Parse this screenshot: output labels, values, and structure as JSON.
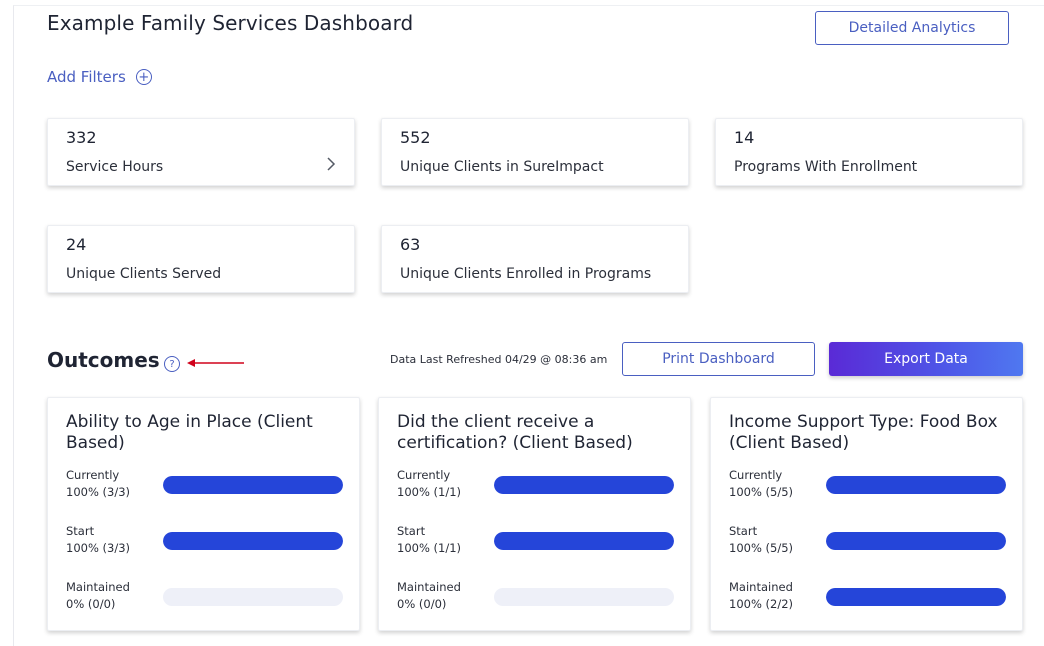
{
  "header": {
    "title": "Example Family Services Dashboard",
    "analytics_button": "Detailed Analytics",
    "add_filters": "Add Filters",
    "add_filters_icon": "plus-circle-icon"
  },
  "stats": [
    {
      "value": "332",
      "label": "Service Hours",
      "has_chevron": true
    },
    {
      "value": "552",
      "label": "Unique Clients in SureImpact"
    },
    {
      "value": "14",
      "label": "Programs With Enrollment"
    },
    {
      "value": "24",
      "label": "Unique Clients Served"
    },
    {
      "value": "63",
      "label": "Unique Clients Enrolled in Programs"
    }
  ],
  "outcomes": {
    "title": "Outcomes",
    "help_icon": "question-circle-icon",
    "refreshed": "Data Last Refreshed 04/29 @ 08:36 am",
    "print_button": "Print Dashboard",
    "export_button": "Export Data",
    "cards": [
      {
        "title": "Ability to Age in Place (Client Based)",
        "metrics": [
          {
            "name": "Currently",
            "value": "100% (3/3)",
            "fill": 1.0
          },
          {
            "name": "Start",
            "value": "100% (3/3)",
            "fill": 1.0
          },
          {
            "name": "Maintained",
            "value": "0% (0/0)",
            "fill": 0.0
          }
        ]
      },
      {
        "title": "Did the client receive a certification? (Client Based)",
        "metrics": [
          {
            "name": "Currently",
            "value": "100% (1/1)",
            "fill": 1.0
          },
          {
            "name": "Start",
            "value": "100% (1/1)",
            "fill": 1.0
          },
          {
            "name": "Maintained",
            "value": "0% (0/0)",
            "fill": 0.0
          }
        ]
      },
      {
        "title": "Income Support Type: Food Box (Client Based)",
        "metrics": [
          {
            "name": "Currently",
            "value": "100% (5/5)",
            "fill": 1.0
          },
          {
            "name": "Start",
            "value": "100% (5/5)",
            "fill": 1.0
          },
          {
            "name": "Maintained",
            "value": "100% (2/2)",
            "fill": 1.0
          }
        ]
      }
    ]
  },
  "colors": {
    "accent": "#4a5fc1",
    "bar_fill": "#2545d9",
    "bar_track": "#eef0f8",
    "export_gradient_start": "#5a2ad6",
    "export_gradient_end": "#4f78f0",
    "annotation_arrow": "#d0021b"
  }
}
